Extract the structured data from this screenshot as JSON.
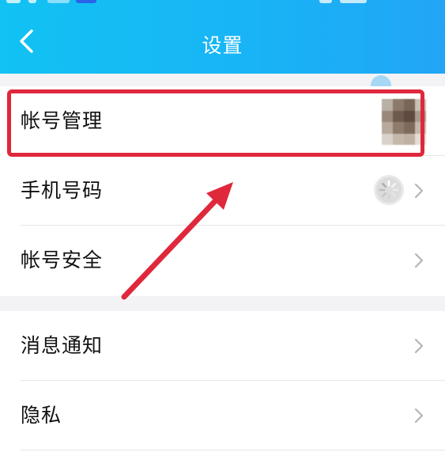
{
  "header": {
    "title": "设置",
    "back_icon": "chevron-left-icon",
    "background_colors": [
      "#12c2f4",
      "#22a5f6"
    ]
  },
  "settings": {
    "group1": [
      {
        "label": "帐号管理",
        "trailing": "avatar-blurred",
        "chevron": "chevron-right-icon"
      },
      {
        "label": "手机号码",
        "trailing": "loading-spinner-icon",
        "chevron": "chevron-right-icon"
      },
      {
        "label": "帐号安全",
        "chevron": "chevron-right-icon"
      }
    ],
    "group2": [
      {
        "label": "消息通知",
        "chevron": "chevron-right-icon"
      },
      {
        "label": "隐私",
        "chevron": "chevron-right-icon"
      }
    ]
  },
  "annotation": {
    "highlight_color": "#e0283c",
    "arrow_color": "#e0283c",
    "highlighted_item": "帐号管理"
  }
}
